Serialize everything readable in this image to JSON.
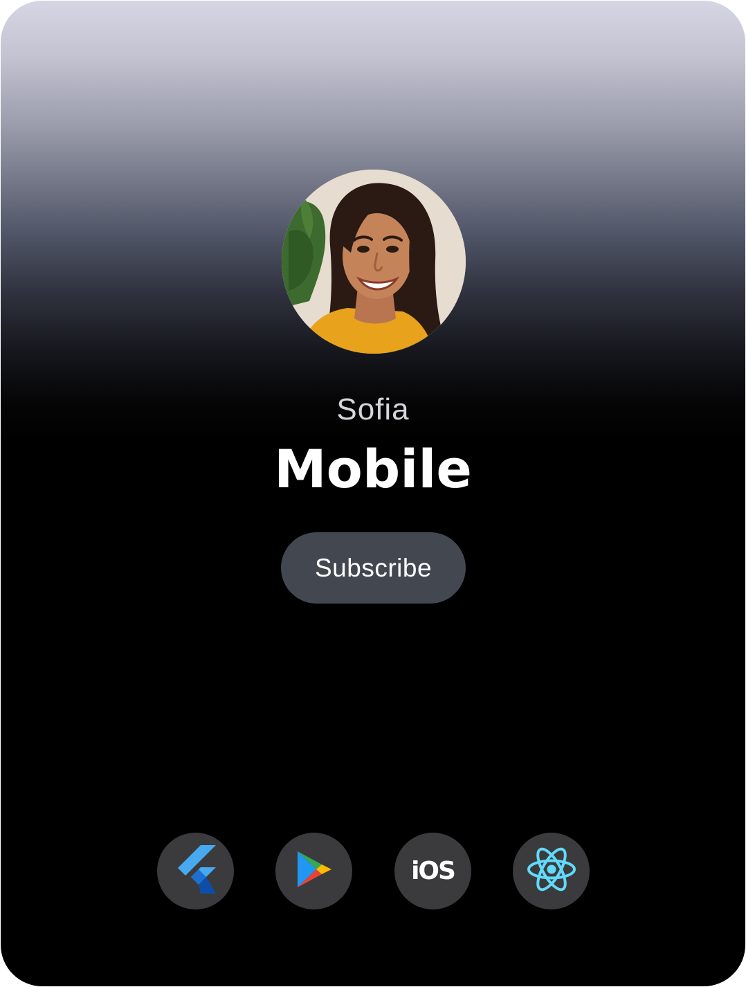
{
  "profile": {
    "name": "Sofia",
    "category": "Mobile",
    "subscribe_label": "Subscribe"
  },
  "platforms": [
    {
      "icon": "flutter-icon",
      "label": ""
    },
    {
      "icon": "google-play-icon",
      "label": ""
    },
    {
      "icon": "ios-icon",
      "label": "iOS"
    },
    {
      "icon": "react-icon",
      "label": ""
    }
  ],
  "colors": {
    "card_top": "#d6d5e3",
    "card_bottom": "#000000",
    "button_bg": "#434850",
    "icon_circle_bg": "#3b3b3d",
    "react_accent": "#61dafb"
  }
}
